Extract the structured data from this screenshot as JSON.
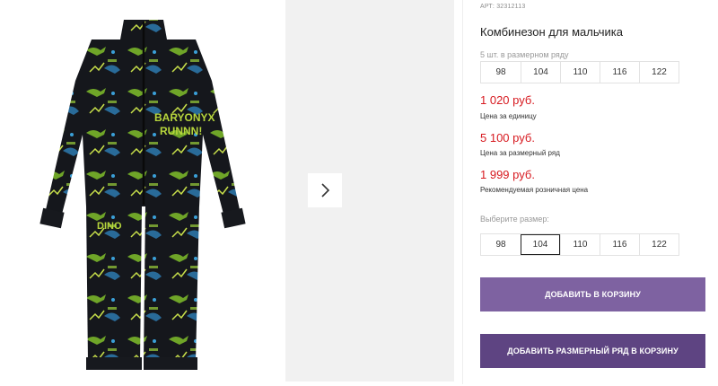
{
  "product": {
    "sku": "АРТ: 32312113",
    "title": "Комбинезон для мальчика"
  },
  "pack": {
    "label": "5 шт. в размерном ряду",
    "sizes": [
      "98",
      "104",
      "110",
      "116",
      "122"
    ]
  },
  "prices": [
    {
      "value": "1 020 руб.",
      "note": "Цена за единицу"
    },
    {
      "value": "5 100 руб.",
      "note": "Цена за размерный ряд"
    },
    {
      "value": "1 999 руб.",
      "note": "Рекомендуемая розничная цена"
    }
  ],
  "size_select": {
    "label": "Выберите размер:",
    "sizes": [
      "98",
      "104",
      "110",
      "116",
      "122"
    ],
    "selected": "104"
  },
  "buttons": {
    "add_to_cart": "ДОБАВИТЬ В КОРЗИНУ",
    "add_size_row": "ДОБАВИТЬ РАЗМЕРНЫЙ РЯД В КОРЗИНУ"
  },
  "colors": {
    "price": "#d71a20",
    "button_primary": "#7e62a1",
    "button_secondary": "#5e4482"
  },
  "icons": {
    "next": "chevron-right-icon"
  },
  "image_print_text": [
    "BARYONYX",
    "RUNNN!",
    "DINO"
  ]
}
